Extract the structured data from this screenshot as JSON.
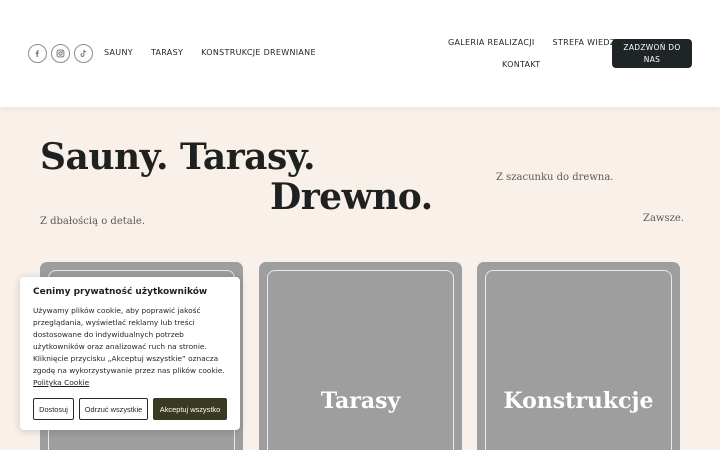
{
  "header": {
    "socials": [
      {
        "icon": "facebook-icon"
      },
      {
        "icon": "instagram-icon"
      },
      {
        "icon": "tiktok-icon"
      }
    ],
    "nav_left": [
      "SAUNY",
      "TARASY",
      "KONSTRUKCJE DREWNIANE"
    ],
    "nav_right": [
      "GALERIA REALIZACJI",
      "STREFA WIEDZY",
      "KONTAKT"
    ],
    "cta_label": "ZADZWOŃ DO NAS"
  },
  "hero": {
    "line1": "Sauny. Tarasy.",
    "line2": "Drewno.",
    "tagline_right": "Z szacunku do drewna.",
    "tagline_left": "Z dbałością o detale.",
    "tagline_end": "Zawsze."
  },
  "cards": [
    {
      "title": ""
    },
    {
      "title": "Tarasy"
    },
    {
      "title": "Konstrukcje"
    }
  ],
  "cookie": {
    "title": "Cenimy prywatność użytkowników",
    "text": "Używamy plików cookie, aby poprawić jakość przeglądania, wyświetlać reklamy lub treści dostosowane do indywidualnych potrzeb użytkowników oraz analizować ruch na stronie. Kliknięcie przycisku „Akceptuj wszystkie” oznacza zgodę na wykorzystywanie przez nas plików cookie.",
    "policy_link": "Polityka Cookie",
    "buttons": {
      "reject": "Dostosuj",
      "customize": "Odrzuć wszystkie",
      "accept": "Akceptuj wszystko"
    }
  },
  "colors": {
    "background": "#f8f0e9",
    "header": "#ffffff",
    "cta": "#1f2527",
    "card": "#9e9e9e",
    "accept_button": "#3a3a22"
  }
}
